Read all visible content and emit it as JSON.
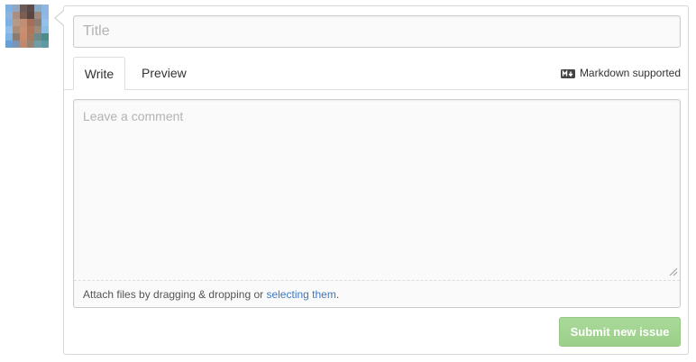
{
  "avatar": {
    "pixels": [
      "#7fb1e0",
      "#8fa6c0",
      "#6b5a57",
      "#5f4b4a",
      "#8aa9c5",
      "#8db6e1",
      "#8ab4dd",
      "#a88e84",
      "#7b5e50",
      "#5a4540",
      "#9d8a82",
      "#8fb7e3",
      "#7fb0e2",
      "#b59a8a",
      "#c08f73",
      "#a66e58",
      "#8c7c70",
      "#93c1e8",
      "#93bde9",
      "#a78e7d",
      "#c98f71",
      "#b0765b",
      "#9d8b7c",
      "#8bbce6",
      "#7fb4e6",
      "#8a7c70",
      "#c88c6c",
      "#a77a62",
      "#6d8a8c",
      "#4d8a8a",
      "#6a9fd6",
      "#7a95b5",
      "#bf8a6c",
      "#9a8270",
      "#6e9ea6",
      "#5d9aa2"
    ]
  },
  "form": {
    "title_placeholder": "Title",
    "tabs": {
      "write": "Write",
      "preview": "Preview"
    },
    "markdown_label": "Markdown supported",
    "comment_placeholder": "Leave a comment",
    "attach_text": "Attach files by dragging & dropping or ",
    "attach_link": "selecting them",
    "attach_end": ".",
    "submit_label": "Submit new issue"
  }
}
